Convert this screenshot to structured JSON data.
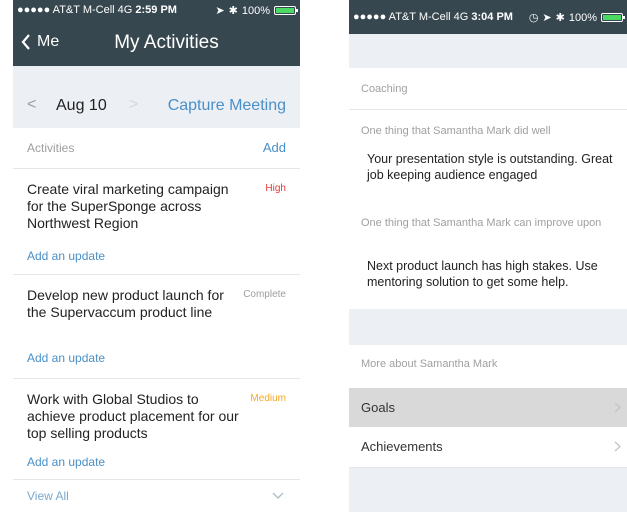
{
  "left": {
    "status": {
      "carrier": "●●●●● AT&T M-Cell  4G",
      "time": "2:59 PM",
      "battery": "100%"
    },
    "nav": {
      "back_label": "Me",
      "title": "My Activities"
    },
    "datebar": {
      "date": "Aug 10",
      "capture": "Capture Meeting"
    },
    "activities_header": {
      "label": "Activities",
      "add": "Add"
    },
    "activities": [
      {
        "title": "Create viral marketing campaign for the SuperSponge across Northwest Region",
        "priority": "High",
        "priority_color": "#e53935",
        "update": "Add an update"
      },
      {
        "title": "Develop new product launch for the Supervaccum product line",
        "priority": "Complete",
        "priority_color": "#9e9e9e",
        "update": "Add an update"
      },
      {
        "title": "Work with Global Studios to achieve product placement for our top selling products",
        "priority": "Medium",
        "priority_color": "#f5a623",
        "update": "Add an update"
      }
    ],
    "view_all": "View All"
  },
  "right": {
    "status": {
      "carrier": "●●●●● AT&T M-Cell  4G",
      "time": "3:04 PM",
      "battery": "100%"
    },
    "coaching_label": "Coaching",
    "did_well_label": "One thing that Samantha Mark did well",
    "did_well_text": "Your presentation style is outstanding. Great job keeping audience engaged",
    "improve_label": "One thing that Samantha Mark can improve upon",
    "improve_text": "Next product launch has high stakes. Use mentoring solution to get some help.",
    "more_label": "More about Samantha Mark",
    "rows": [
      "Goals",
      "Achievements"
    ]
  },
  "colors": {
    "navbar": "#37474f",
    "accent": "#4a90c8",
    "battery": "#4cd964"
  }
}
